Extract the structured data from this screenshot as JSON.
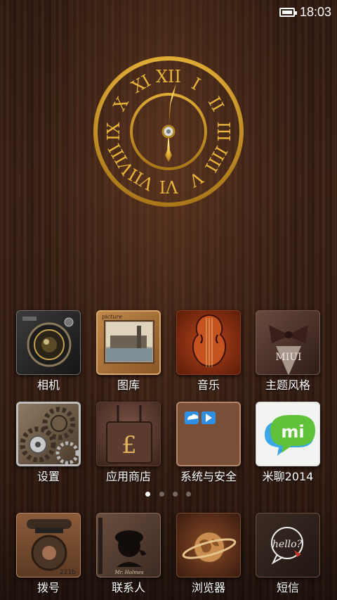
{
  "status_bar": {
    "time": "18:03",
    "battery_icon": "battery-icon"
  },
  "clock": {
    "numerals": [
      "XII",
      "I",
      "II",
      "III",
      "IIII",
      "V",
      "VI",
      "VII",
      "VIII",
      "IX",
      "X",
      "XI"
    ]
  },
  "apps_row1": [
    {
      "label": "相机",
      "icon": "camera-icon"
    },
    {
      "label": "图库",
      "icon": "gallery-icon",
      "badge": "picture"
    },
    {
      "label": "音乐",
      "icon": "music-icon"
    },
    {
      "label": "主题风格",
      "icon": "theme-icon",
      "badge": "MIUI"
    }
  ],
  "apps_row2": [
    {
      "label": "设置",
      "icon": "settings-icon"
    },
    {
      "label": "应用商店",
      "icon": "app-store-icon",
      "badge": "£"
    },
    {
      "label": "系统与安全",
      "icon": "system-security-icon"
    },
    {
      "label": "米聊2014",
      "icon": "miliao-icon",
      "badge": "mi"
    }
  ],
  "dock": [
    {
      "label": "拨号",
      "icon": "phone-icon",
      "badge": "221b"
    },
    {
      "label": "联系人",
      "icon": "contacts-icon",
      "badge": "Mr. Holmes"
    },
    {
      "label": "浏览器",
      "icon": "browser-icon"
    },
    {
      "label": "短信",
      "icon": "messages-icon",
      "badge": "hello?"
    }
  ],
  "pager": {
    "pages": 4,
    "active": 1
  },
  "colors": {
    "gold": "#e8b53a",
    "wood_dark": "#2f1a11",
    "wood_mid": "#4a2c1e",
    "mi_green": "#5fc23a"
  }
}
